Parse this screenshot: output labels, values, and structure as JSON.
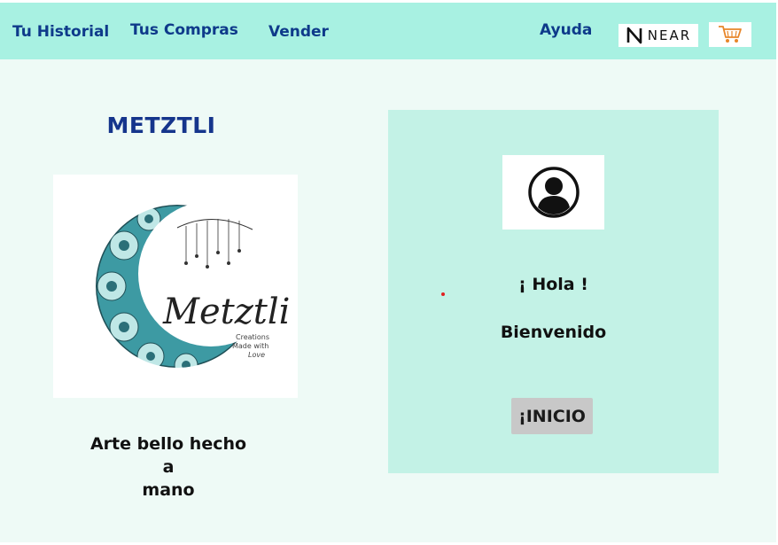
{
  "nav": {
    "links": [
      {
        "label": "Tu Historial"
      },
      {
        "label": "Tus Compras"
      },
      {
        "label": "Vender"
      },
      {
        "label": "Ayuda"
      }
    ],
    "wallet_logo_text": "NEAR",
    "cart_icon": "shopping-cart-icon"
  },
  "brand": {
    "title": "METZTLI",
    "logo_text": "Metztli",
    "logo_subtext": "Creations Made with Love",
    "tagline_lines": [
      "Arte bello hecho",
      "a",
      "mano"
    ]
  },
  "welcome_card": {
    "avatar_icon": "user-avatar-icon",
    "greeting": "¡ Hola !",
    "subtitle": "Bienvenido",
    "button_label": "¡INICIO"
  },
  "colors": {
    "navbar_bg": "#a8f1e2",
    "nav_text": "#0e3a8a",
    "page_bg": "#eefaf6",
    "card_bg": "#c3f2e6",
    "title": "#15358c",
    "button_bg": "#c8c8c8",
    "moon_teal": "#3d9aa3"
  }
}
